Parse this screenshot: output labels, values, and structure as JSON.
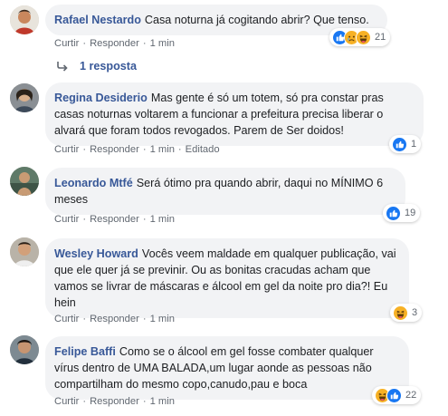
{
  "comments": [
    {
      "author": "Rafael Nestardo",
      "text": "Casa noturna já cogitando abrir? Que tenso.",
      "like_label": "Curtir",
      "reply_label": "Responder",
      "time": "1 min",
      "reaction_count": "21",
      "reaction_icons": [
        "like-icon",
        "sad-icon",
        "haha-icon"
      ]
    },
    {
      "author": "Regina Desiderio",
      "text": "Mas gente é só um totem, só pra constar pras casas noturnas voltarem a funcionar a prefeitura precisa liberar o alvará que foram todos revogados. Parem de Ser doidos!",
      "like_label": "Curtir",
      "reply_label": "Responder",
      "time": "1 min",
      "edited": "Editado",
      "reaction_count": "1",
      "reaction_icons": [
        "like-icon"
      ]
    },
    {
      "author": "Leonardo Mtfé",
      "text": "Será ótimo pra quando abrir, daqui no MÍNIMO 6 meses",
      "like_label": "Curtir",
      "reply_label": "Responder",
      "time": "1 min",
      "reaction_count": "19",
      "reaction_icons": [
        "like-icon"
      ]
    },
    {
      "author": "Wesley Howard",
      "text": "Vocês veem maldade em qualquer publicação, vai que ele quer já se previnir. Ou as bonitas cracudas acham que vamos se livrar de máscaras e álcool em gel da noite pro dia?! Eu hein",
      "like_label": "Curtir",
      "reply_label": "Responder",
      "time": "1 min",
      "reaction_count": "3",
      "reaction_icons": [
        "haha-icon"
      ]
    },
    {
      "author": "Felipe Baffi",
      "text": "Como se o álcool em gel fosse combater qualquer vírus dentro de UMA BALADA,um lugar aonde as pessoas não compartilham do mesmo copo,canudo,pau e boca",
      "like_label": "Curtir",
      "reply_label": "Responder",
      "time": "1 min",
      "reaction_count": "22",
      "reaction_icons": [
        "haha-icon",
        "like-icon"
      ]
    }
  ],
  "replies": {
    "label": "1 resposta"
  },
  "colors": {
    "author": "#385898",
    "bubble": "#f2f3f5",
    "meta": "#606770",
    "like_blue": "#1877f2",
    "haha_yellow": "#f7b125"
  }
}
